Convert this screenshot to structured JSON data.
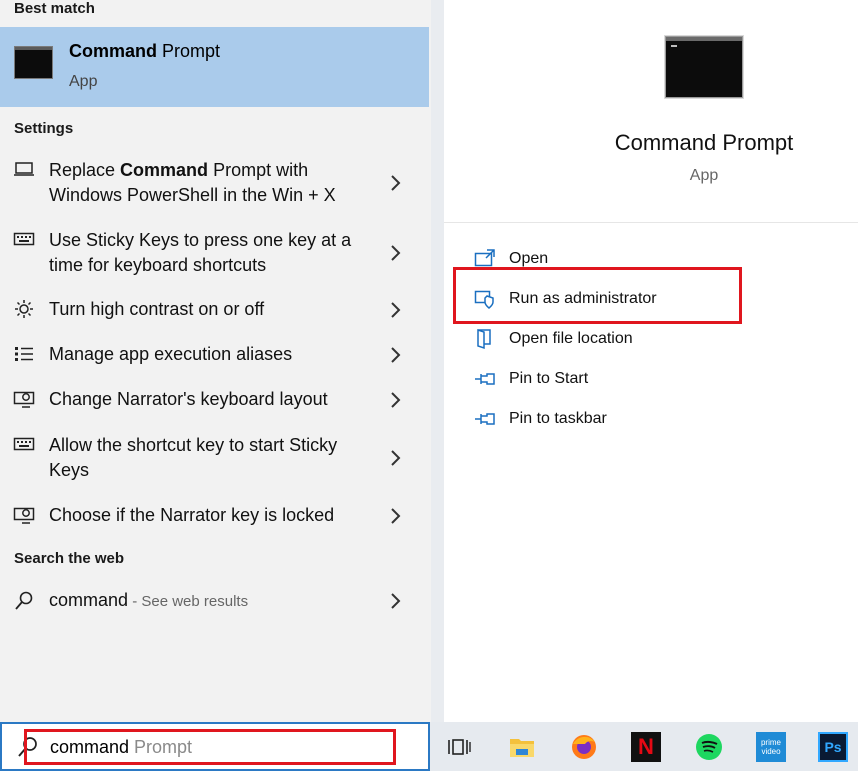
{
  "best_match": {
    "section_title": "Best match",
    "name_bold": "Command",
    "name_rest": " Prompt",
    "subtitle": "App"
  },
  "settings": {
    "section_title": "Settings",
    "items": [
      {
        "icon": "laptop-icon",
        "bold_prefix": "Replace ",
        "bold": "Command",
        "rest": " Prompt with Windows PowerShell in the Win + X"
      },
      {
        "icon": "keyboard-icon",
        "text": "Use Sticky Keys to press one key at a time for keyboard shortcuts"
      },
      {
        "icon": "brightness-icon",
        "text": "Turn high contrast on or off"
      },
      {
        "icon": "list-icon",
        "text": "Manage app execution aliases"
      },
      {
        "icon": "narrator-icon",
        "text": "Change Narrator's keyboard layout"
      },
      {
        "icon": "keyboard-icon",
        "text": "Allow the shortcut key to start Sticky Keys"
      },
      {
        "icon": "narrator-icon",
        "text": "Choose if the Narrator key is locked"
      }
    ]
  },
  "web": {
    "section_title": "Search the web",
    "query": "command",
    "suffix": " - See web results"
  },
  "search": {
    "typed": "command",
    "suggestion": " Prompt"
  },
  "details": {
    "title": "Command Prompt",
    "subtitle": "App",
    "actions": [
      {
        "icon": "open-icon",
        "label": "Open"
      },
      {
        "icon": "shield-icon",
        "label": "Run as administrator"
      },
      {
        "icon": "folder-icon",
        "label": "Open file location"
      },
      {
        "icon": "pin-icon",
        "label": "Pin to Start"
      },
      {
        "icon": "pin-icon",
        "label": "Pin to taskbar"
      }
    ]
  },
  "taskbar": {
    "apps": [
      "task-view-icon",
      "file-explorer-icon",
      "firefox-icon",
      "netflix-icon",
      "spotify-icon",
      "prime-video-icon",
      "photoshop-icon"
    ],
    "netflix_label": "N",
    "prime_label": "prime video",
    "photoshop_label": "Ps"
  },
  "colors": {
    "highlight": "#aacbeb",
    "accent": "#2b79c4",
    "annotation_red": "#e0161e"
  }
}
